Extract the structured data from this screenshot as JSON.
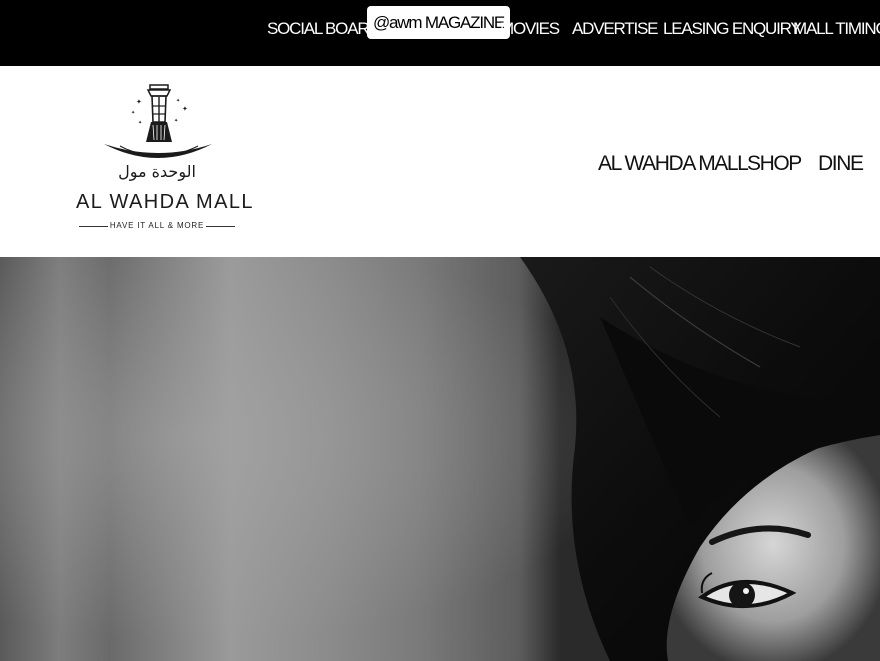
{
  "top_nav": [
    {
      "label": "SOCIAL BOARD"
    },
    {
      "label": "@awm MAGAZINE"
    },
    {
      "label": "MOVIES"
    },
    {
      "label": "ADVERTISE"
    },
    {
      "label": "LEASING ENQUIRY"
    },
    {
      "label": "MALL TIMINGS"
    }
  ],
  "logo": {
    "arabic": "الوحدة مول",
    "name": "AL WAHDA MALL",
    "tagline": "HAVE IT ALL & MORE"
  },
  "main_nav": [
    {
      "label": "AL WAHDA MALL"
    },
    {
      "label": "SHOP"
    },
    {
      "label": "DINE"
    }
  ],
  "hero": {
    "image": "black-and-white portrait of woman with dark hair"
  },
  "colors": {
    "topbar_bg": "#000000",
    "header_bg": "#ffffff",
    "text_dark": "#111111"
  }
}
